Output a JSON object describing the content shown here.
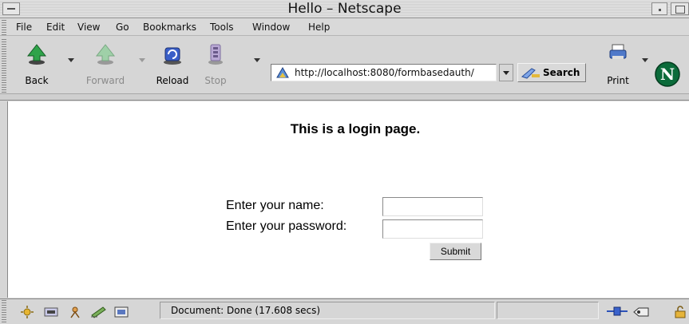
{
  "window": {
    "title": "Hello – Netscape"
  },
  "menu": {
    "items": [
      {
        "label": "File",
        "name": "menu-file"
      },
      {
        "label": "Edit",
        "name": "menu-edit"
      },
      {
        "label": "View",
        "name": "menu-view"
      },
      {
        "label": "Go",
        "name": "menu-go"
      },
      {
        "label": "Bookmarks",
        "name": "menu-bookmarks"
      },
      {
        "label": "Tools",
        "name": "menu-tools"
      },
      {
        "label": "Window",
        "name": "menu-window"
      },
      {
        "label": "Help",
        "name": "menu-help"
      }
    ]
  },
  "toolbar": {
    "back_label": "Back",
    "forward_label": "Forward",
    "reload_label": "Reload",
    "stop_label": "Stop",
    "url": "http://localhost:8080/formbasedauth/",
    "search_label": "Search",
    "print_label": "Print"
  },
  "page": {
    "heading": "This is a login page.",
    "name_label": "Enter your name:",
    "password_label": "Enter your password:",
    "name_value": "",
    "password_value": "",
    "submit_label": "Submit"
  },
  "status": {
    "text": "Document: Done (17.608 secs)"
  },
  "colors": {
    "chrome": "#d6d6d6",
    "content_bg": "#ffffff",
    "netscape_logo": "#0b6b3a"
  },
  "icons": [
    "back-arrow-icon",
    "forward-arrow-icon",
    "reload-icon",
    "stop-icon",
    "page-icon",
    "search-icon",
    "print-icon",
    "netscape-logo-icon",
    "navigator-icon",
    "mail-icon",
    "composer-icon",
    "address-book-icon",
    "irc-icon",
    "online-plug-icon",
    "security-icon"
  ]
}
